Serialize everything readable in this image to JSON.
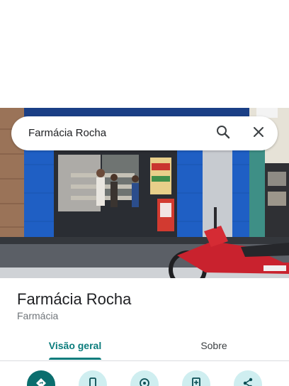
{
  "search": {
    "query": "Farmácia Rocha",
    "search_icon": "search-icon",
    "close_icon": "close-icon"
  },
  "place": {
    "name": "Farmácia Rocha",
    "category": "Farmácia"
  },
  "tabs": [
    {
      "label": "Visão geral",
      "selected": true
    },
    {
      "label": "Sobre",
      "selected": false
    }
  ],
  "actions": [
    {
      "icon": "directions-icon"
    },
    {
      "icon": "phone-icon"
    },
    {
      "icon": "location-icon"
    },
    {
      "icon": "save-icon"
    },
    {
      "icon": "share-icon"
    }
  ],
  "colors": {
    "accent": "#0b7c7c",
    "action_primary": "#0b6e6e",
    "action_secondary": "#cfeef0",
    "storefront_blue": "#1f5fc4"
  }
}
